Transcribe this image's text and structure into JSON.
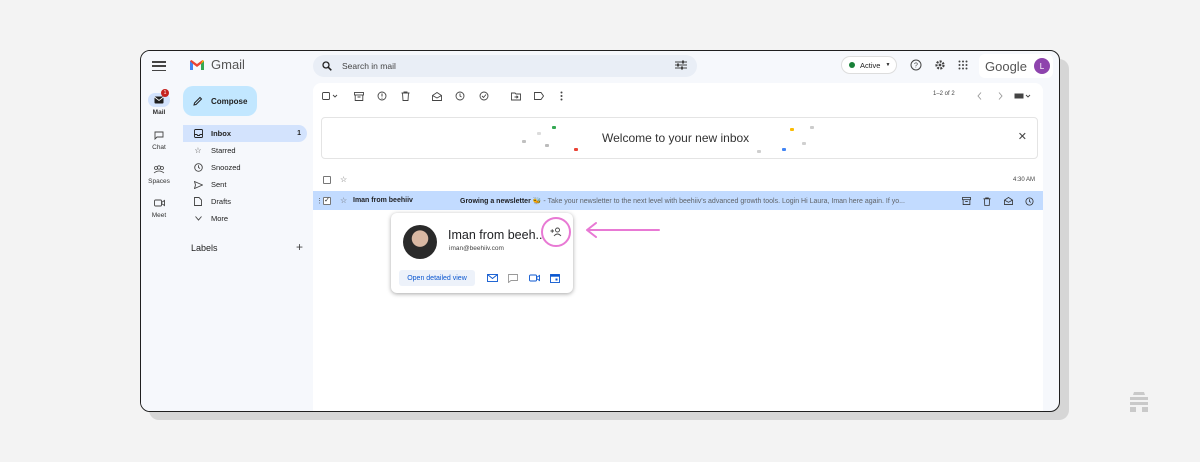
{
  "app": {
    "name": "Gmail",
    "brand": "Google",
    "avatar_initial": "L",
    "accent": "#0b57d0"
  },
  "rail": {
    "items": [
      {
        "label": "Mail",
        "icon": "mail-icon",
        "badge": "1"
      },
      {
        "label": "Chat",
        "icon": "chat-icon"
      },
      {
        "label": "Spaces",
        "icon": "spaces-icon"
      },
      {
        "label": "Meet",
        "icon": "meet-icon"
      }
    ]
  },
  "sidebar": {
    "compose_label": "Compose",
    "items": [
      {
        "label": "Inbox",
        "icon": "inbox-icon",
        "count": "1"
      },
      {
        "label": "Starred",
        "icon": "star-icon"
      },
      {
        "label": "Snoozed",
        "icon": "clock-icon"
      },
      {
        "label": "Sent",
        "icon": "send-icon"
      },
      {
        "label": "Drafts",
        "icon": "draft-icon"
      },
      {
        "label": "More",
        "icon": "chevron-down-icon"
      }
    ],
    "labels_heading": "Labels",
    "labels_add": "+"
  },
  "search": {
    "placeholder": "Search in mail"
  },
  "status": {
    "label": "Active",
    "color": "#188038"
  },
  "toolbar": {
    "pager": "1–2 of 2"
  },
  "welcome": {
    "text": "Welcome to your new inbox",
    "close": "✕"
  },
  "emails": [
    {
      "sender": "",
      "subject": "",
      "snippet": "",
      "time": "4:30 AM"
    },
    {
      "sender": "Iman from beehiiv",
      "subject": "Growing a newsletter 🐝",
      "snippet": " - Take your newsletter to the next level with beehiiv's advanced growth tools.  Login Hi Laura, Iman here again. If yo...",
      "time": ""
    }
  ],
  "hover_card": {
    "name": "Iman from beeh...",
    "email": "iman@beehiiv.com",
    "open_label": "Open detailed view"
  }
}
